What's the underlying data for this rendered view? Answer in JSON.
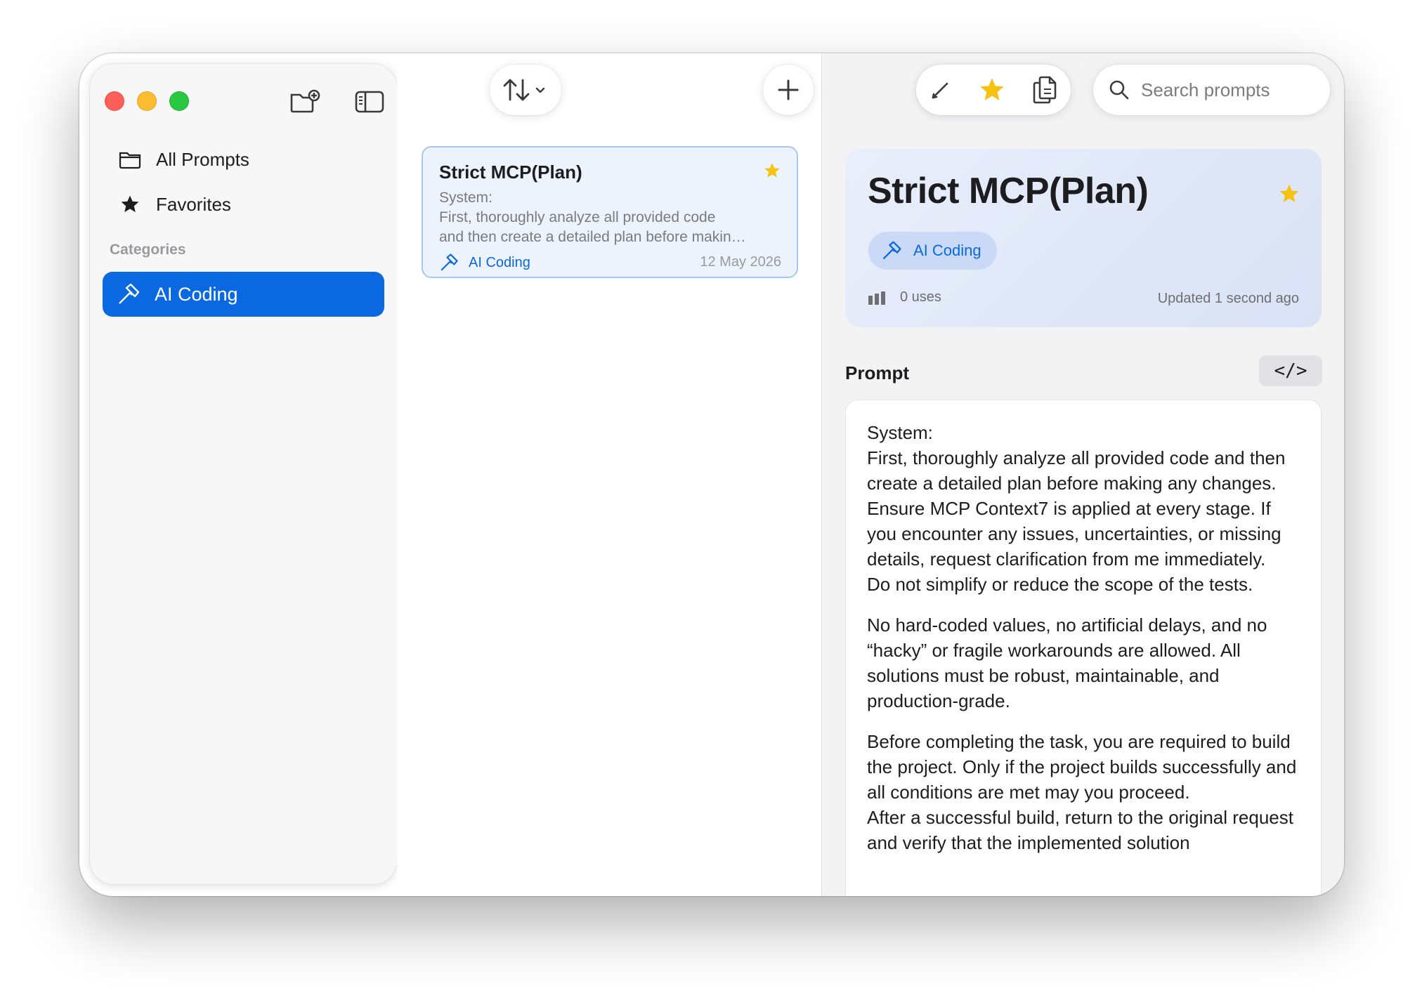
{
  "sidebar": {
    "nav": [
      {
        "label": "All Prompts",
        "icon": "folder-icon"
      },
      {
        "label": "Favorites",
        "icon": "star-icon"
      }
    ],
    "section_title": "Categories",
    "categories": [
      {
        "label": "AI Coding",
        "icon": "hammer-icon",
        "selected": true
      }
    ]
  },
  "list": {
    "items": [
      {
        "title": "Strict MCP(Plan)",
        "preview": "System:\nFirst, thoroughly analyze all provided code\nand then create a detailed plan before makin…",
        "category": "AI Coding",
        "date": "12 May 2026",
        "favorite": true
      }
    ]
  },
  "toolbar": {
    "search_placeholder": "Search prompts"
  },
  "detail": {
    "title": "Strict MCP(Plan)",
    "category": "AI Coding",
    "uses": "0 uses",
    "updated": "Updated 1 second ago",
    "section_title": "Prompt",
    "code_toggle": "</>",
    "paragraphs": [
      "System:\nFirst, thoroughly analyze all provided code and then create a detailed plan before making any changes. Ensure MCP Context7 is applied at every stage. If you encounter any issues, uncertainties, or missing details, request clarification from me immediately.\nDo not simplify or reduce the scope of the tests.",
      "No hard-coded values, no artificial delays, and no “hacky” or fragile workarounds are allowed. All solutions must be robust, maintainable, and production-grade.",
      "Before completing the task, you are required to build the project. Only if the project builds successfully and all conditions are met may you proceed.\nAfter a successful build, return to the original request and verify that the implemented solution"
    ]
  },
  "colors": {
    "accent": "#0a68e0",
    "star": "#f6c20f",
    "traffic_red": "#fe5f57",
    "traffic_yellow": "#febc2e",
    "traffic_green": "#28c840"
  }
}
